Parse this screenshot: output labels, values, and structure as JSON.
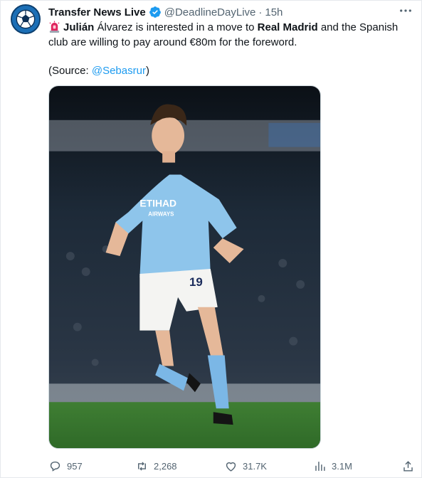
{
  "author": {
    "display_name": "Transfer News Live",
    "handle": "@DeadlineDayLive",
    "separator": "·",
    "time": "15h",
    "verified": true,
    "avatar_icon": "soccer-ball-icon"
  },
  "tweet": {
    "siren_icon": "police-light-emoji-icon",
    "parts": {
      "p1": "Julián",
      "p2": " Álvarez is interested in a move to ",
      "p3": "Real Madrid",
      "p4": " and the Spanish club are willing to pay around €80m for the foreword."
    },
    "source_prefix": "(Source: ",
    "source_mention": "@Sebasrur",
    "source_suffix": ")"
  },
  "media": {
    "description_icon": "football-player-photo",
    "shirt_sponsor_line1": "ETIHAD",
    "shirt_sponsor_line2": "AIRWAYS",
    "shirt_number": "19"
  },
  "actions": {
    "replies": "957",
    "retweets": "2,268",
    "likes": "31.7K",
    "views": "3.1M"
  },
  "colors": {
    "accent": "#1d9bf0",
    "muted": "#536471",
    "text": "#0f1419"
  }
}
